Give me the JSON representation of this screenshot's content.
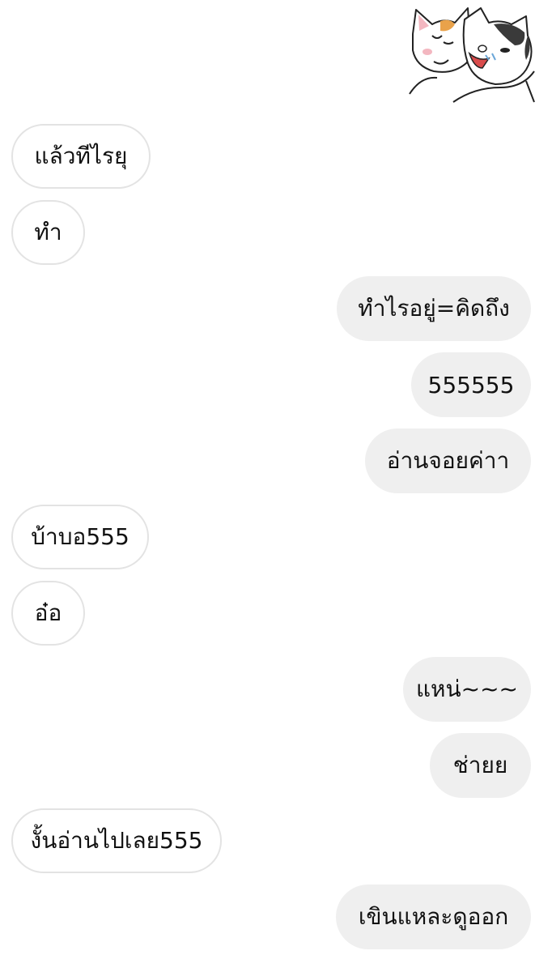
{
  "sticker": {
    "icon": "two-cats-cuddling-sticker"
  },
  "messages": [
    {
      "side": "incoming",
      "text": "แล้วทีไรยุ"
    },
    {
      "side": "incoming",
      "text": "ทำ"
    },
    {
      "side": "outgoing",
      "text": "ทำไรอยู่=คิดถึง"
    },
    {
      "side": "outgoing",
      "text": "555555"
    },
    {
      "side": "outgoing",
      "text": "อ่านจอยค่าา"
    },
    {
      "side": "incoming",
      "text": "บ้าบอ555"
    },
    {
      "side": "incoming",
      "text": "อ๋อ"
    },
    {
      "side": "outgoing",
      "text": "แหน่~~~"
    },
    {
      "side": "outgoing",
      "text": "ช่ายย"
    },
    {
      "side": "incoming",
      "text": "งั้นอ่านไปเลย555"
    },
    {
      "side": "outgoing",
      "text": "เขินแหละดูออก"
    }
  ]
}
